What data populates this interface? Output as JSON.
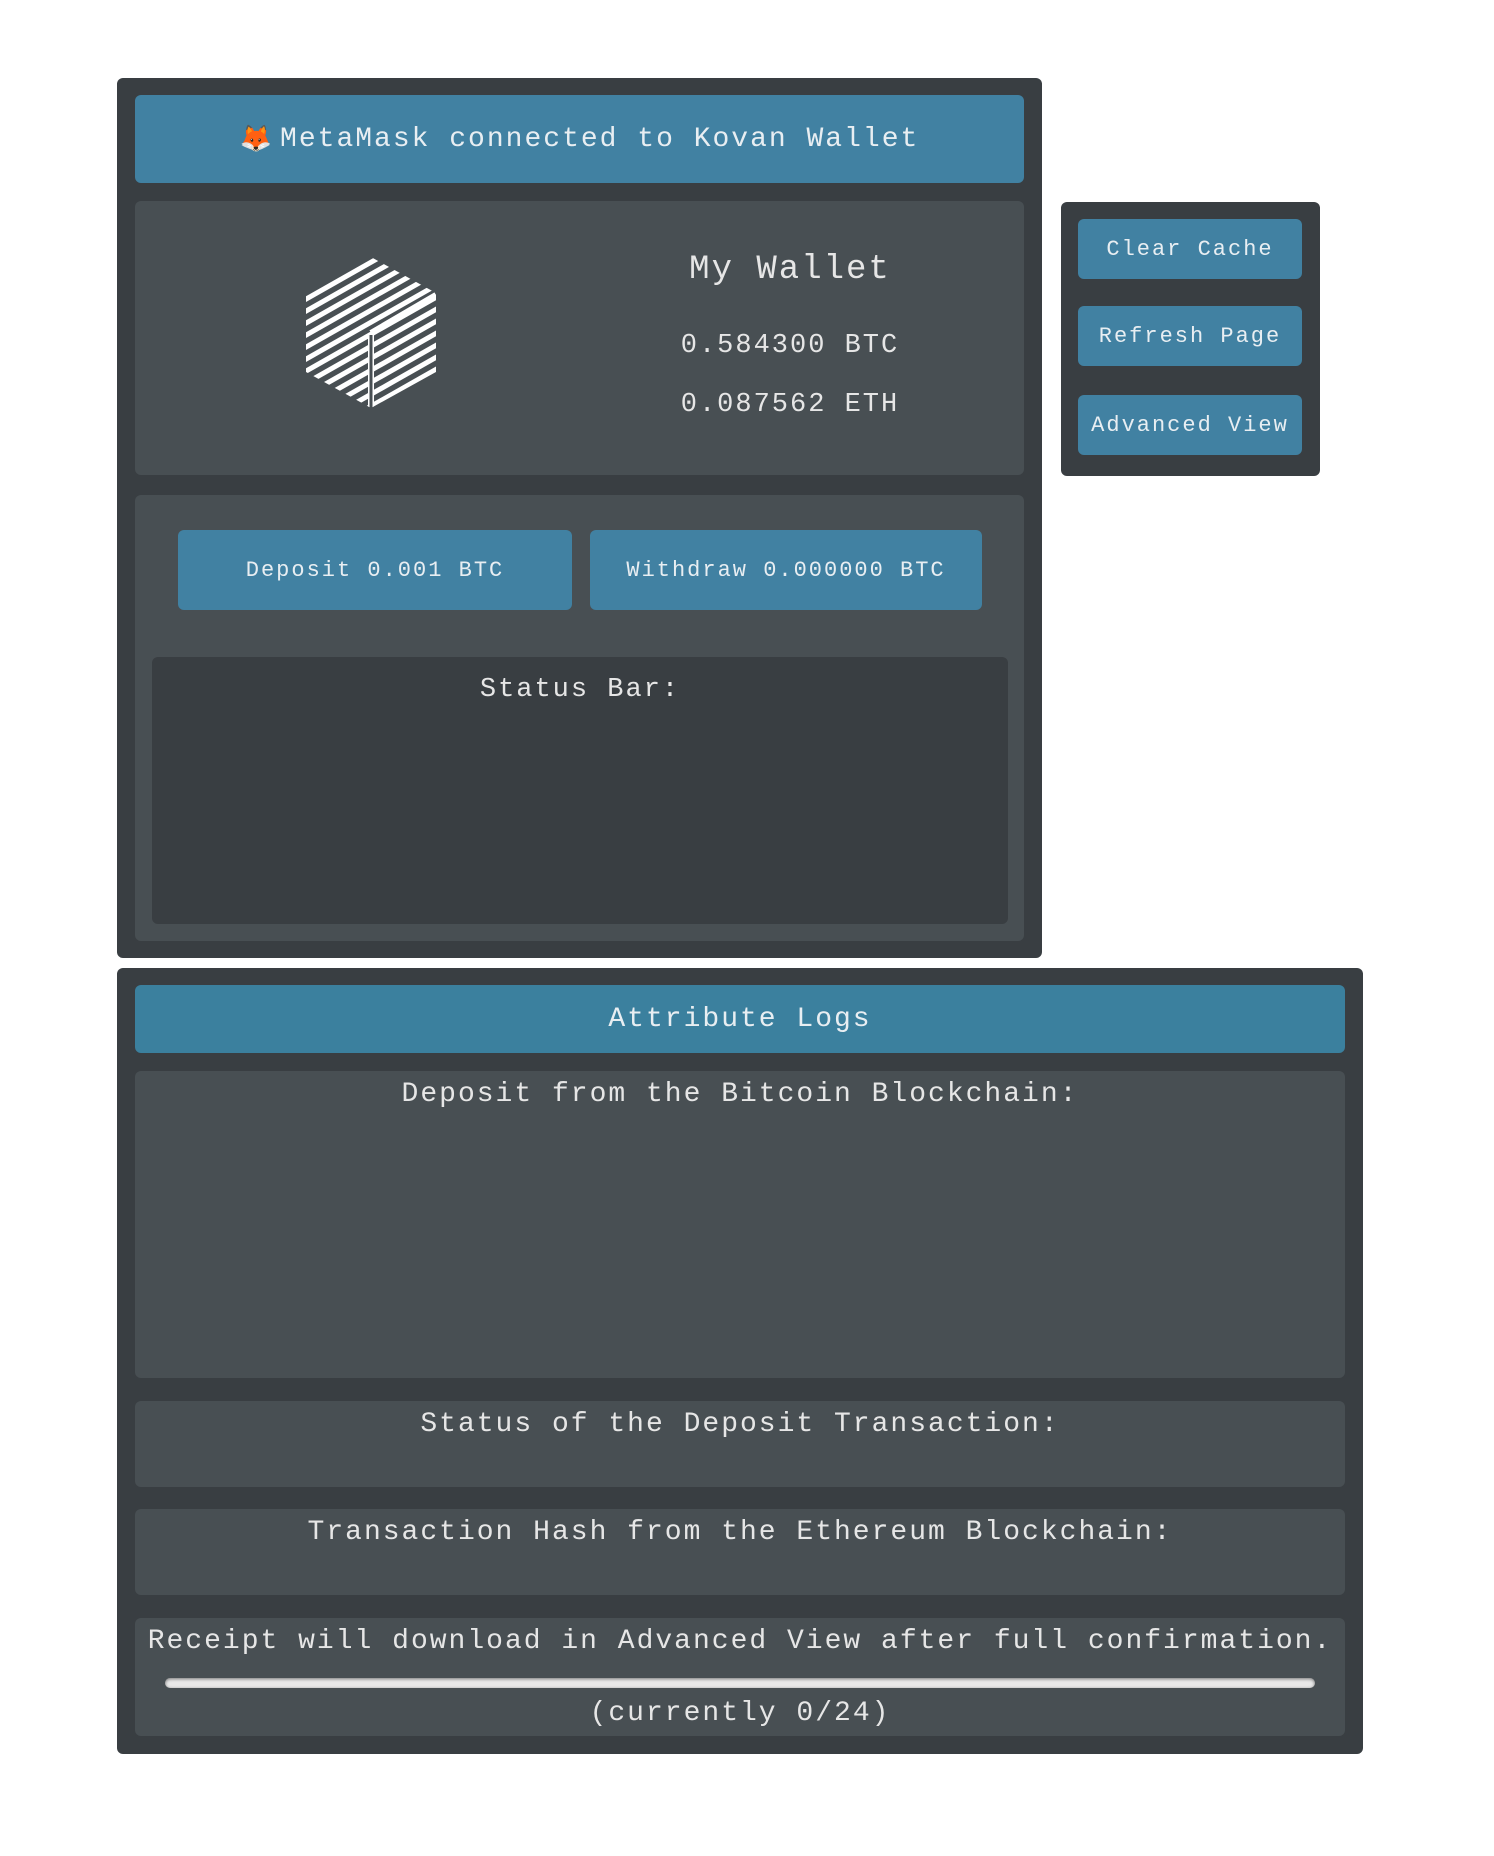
{
  "header": {
    "icon": "fox-icon",
    "connection_text": "MetaMask connected to Kovan Wallet"
  },
  "wallet": {
    "logo_icon": "cube-logo-icon",
    "title": "My Wallet",
    "btc_balance": "0.584300 BTC",
    "eth_balance": "0.087562 ETH"
  },
  "actions": {
    "deposit_label": "Deposit 0.001 BTC",
    "withdraw_label": "Withdraw 0.000000 BTC"
  },
  "status_bar": {
    "label": "Status Bar:"
  },
  "side_menu": {
    "clear_cache": "Clear Cache",
    "refresh_page": "Refresh Page",
    "advanced_view": "Advanced View"
  },
  "logs": {
    "title": "Attribute Logs",
    "deposit_label": "Deposit from the Bitcoin Blockchain:",
    "tx_status_label": "Status of the Deposit Transaction:",
    "tx_hash_label": "Transaction Hash from the Ethereum Blockchain:",
    "receipt_label": "Receipt will download in Advanced View after full confirmation.",
    "confirmations": {
      "current": 0,
      "total": 24,
      "text": "(currently 0/24)"
    }
  },
  "colors": {
    "accent": "#4181a2",
    "panel": "#393e42",
    "inner": "#484f53"
  }
}
